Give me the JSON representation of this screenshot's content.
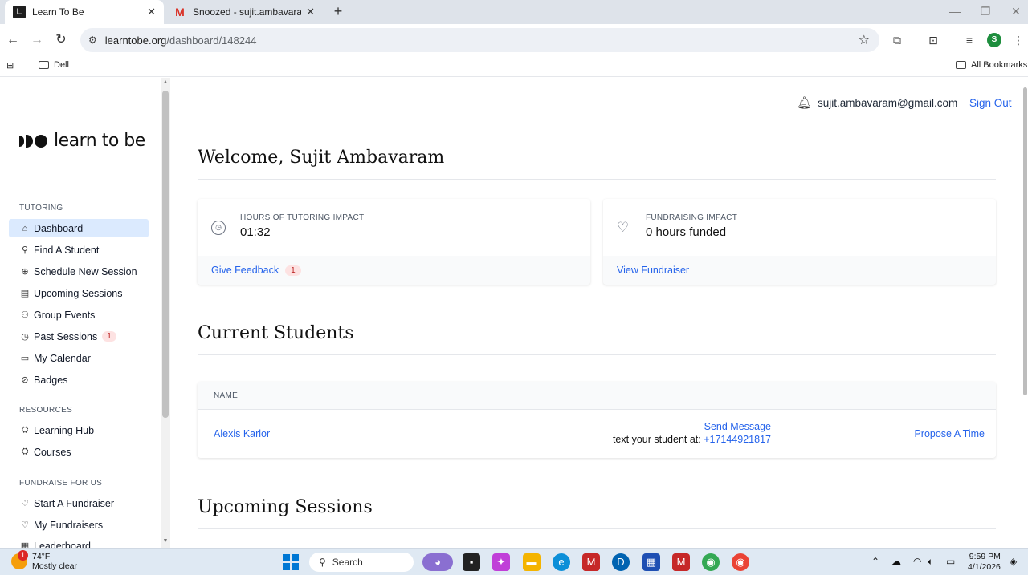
{
  "browser": {
    "tabs": [
      {
        "title": "Learn To Be",
        "favicon": "L"
      },
      {
        "title": "Snoozed - sujit.ambavaram@gr",
        "favicon": "M"
      }
    ],
    "url_domain": "learntobe.org",
    "url_path": "/dashboard/148244",
    "bookmarks": {
      "dell": "Dell",
      "all": "All Bookmarks"
    },
    "profile_initial": "S"
  },
  "brand": {
    "name": "learn to be"
  },
  "header": {
    "email": "sujit.ambavaram@gmail.com",
    "signout": "Sign Out"
  },
  "sidebar": {
    "tutoring_label": "TUTORING",
    "resources_label": "RESOURCES",
    "fundraise_label": "FUNDRAISE FOR US",
    "items": {
      "dashboard": "Dashboard",
      "find_student": "Find A Student",
      "schedule": "Schedule New Session",
      "upcoming": "Upcoming Sessions",
      "group_events": "Group Events",
      "past_sessions": "Past Sessions",
      "past_sessions_badge": "1",
      "calendar": "My Calendar",
      "badges": "Badges",
      "learning_hub": "Learning Hub",
      "courses": "Courses",
      "start_fundraiser": "Start A Fundraiser",
      "my_fundraisers": "My Fundraisers",
      "leaderboard": "Leaderboard"
    }
  },
  "main": {
    "welcome": "Welcome, Sujit Ambavaram",
    "tutoring_impact": {
      "label": "HOURS OF TUTORING IMPACT",
      "value": "01:32",
      "link": "Give Feedback",
      "badge": "1"
    },
    "fundraising_impact": {
      "label": "FUNDRAISING IMPACT",
      "value": "0 hours funded",
      "link": "View Fundraiser"
    },
    "current_students_title": "Current Students",
    "table_header": "NAME",
    "student": {
      "name": "Alexis Karlor",
      "send_message": "Send Message",
      "text_prefix": "text your student at: ",
      "phone": "+17144921817",
      "propose": "Propose A Time"
    },
    "upcoming_title": "Upcoming Sessions"
  },
  "taskbar": {
    "temp": "74°F",
    "weather": "Mostly clear",
    "weather_badge": "1",
    "search": "Search",
    "time": "9:59 PM",
    "date": "4/1/2026"
  }
}
